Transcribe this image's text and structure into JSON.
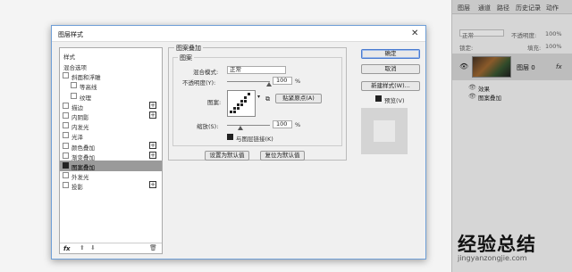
{
  "dialog": {
    "title": "图层样式",
    "close": "✕"
  },
  "style_list": {
    "header": "样式",
    "items": [
      {
        "label": "混合选项",
        "checkbox": false,
        "plus": false,
        "checked": false,
        "selected": false
      },
      {
        "label": "斜面和浮雕",
        "checkbox": true,
        "plus": false,
        "checked": false,
        "selected": false
      },
      {
        "label": "等高线",
        "checkbox": true,
        "plus": false,
        "checked": false,
        "selected": false,
        "indent": true
      },
      {
        "label": "纹理",
        "checkbox": true,
        "plus": false,
        "checked": false,
        "selected": false,
        "indent": true
      },
      {
        "label": "描边",
        "checkbox": true,
        "plus": true,
        "checked": false,
        "selected": false
      },
      {
        "label": "内阴影",
        "checkbox": true,
        "plus": true,
        "checked": false,
        "selected": false
      },
      {
        "label": "内发光",
        "checkbox": true,
        "plus": false,
        "checked": false,
        "selected": false
      },
      {
        "label": "光泽",
        "checkbox": true,
        "plus": false,
        "checked": false,
        "selected": false
      },
      {
        "label": "颜色叠加",
        "checkbox": true,
        "plus": true,
        "checked": false,
        "selected": false
      },
      {
        "label": "渐变叠加",
        "checkbox": true,
        "plus": true,
        "checked": false,
        "selected": false
      },
      {
        "label": "图案叠加",
        "checkbox": true,
        "plus": false,
        "checked": true,
        "selected": true
      },
      {
        "label": "外发光",
        "checkbox": true,
        "plus": false,
        "checked": false,
        "selected": false
      },
      {
        "label": "投影",
        "checkbox": true,
        "plus": true,
        "checked": false,
        "selected": false
      }
    ],
    "footer_fx": "fx"
  },
  "pattern_overlay": {
    "group_title": "图案叠加",
    "subgroup_title": "图案",
    "blend_label": "混合模式:",
    "blend_value": "正常",
    "opacity_label": "不透明度(Y):",
    "opacity_value": "100",
    "opacity_unit": "%",
    "pattern_label": "图案:",
    "snap_button": "贴紧原点(A)",
    "scale_label": "缩放(S):",
    "scale_value": "100",
    "scale_unit": "%",
    "link_label": "与图层链接(K)",
    "link_checked": true,
    "make_default": "设置为默认值",
    "reset_default": "复位为默认值"
  },
  "right_buttons": {
    "ok": "确定",
    "cancel": "取消",
    "new_style": "新建样式(W)...",
    "preview_label": "预览(V)",
    "preview_checked": true
  },
  "layers_panel": {
    "tabs": [
      "图层",
      "通道",
      "路径",
      "历史记录",
      "动作"
    ],
    "mode": "正常",
    "opacity_label": "不透明度:",
    "opacity_value": "100%",
    "lock_label": "锁定:",
    "fill_label": "填充:",
    "fill_value": "100%",
    "layer_name": "图层 0",
    "fx_label": "fx",
    "effects_label": "效果",
    "effect_item": "图案叠加"
  },
  "watermark": {
    "logo": "经验总结",
    "url": "jingyanzongjie.com"
  }
}
